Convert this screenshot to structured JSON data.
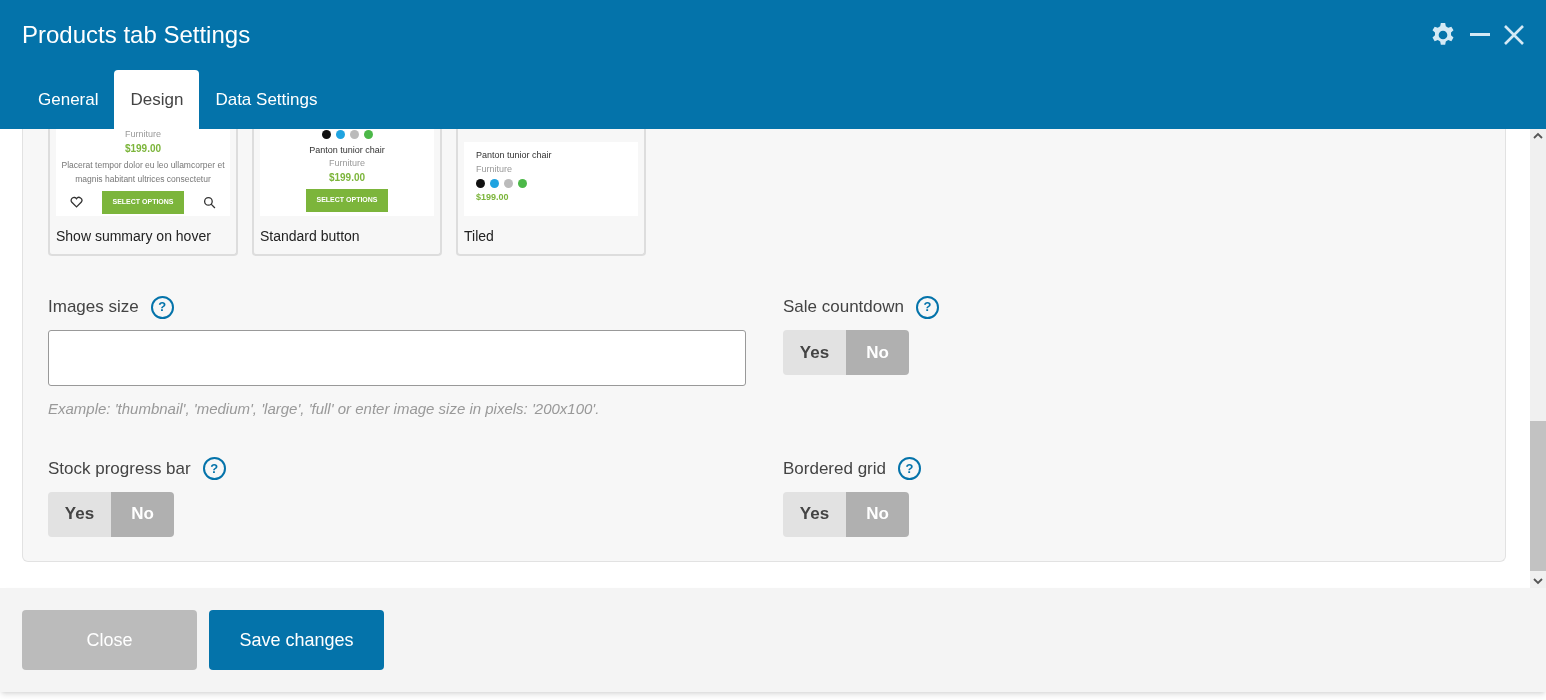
{
  "window": {
    "title": "Products tab Settings"
  },
  "tabs": [
    {
      "label": "General",
      "selected": false
    },
    {
      "label": "Design",
      "selected": true
    },
    {
      "label": "Data Settings",
      "selected": false
    }
  ],
  "design_cards": [
    {
      "kind": "hover",
      "category": "Furniture",
      "price": "$199.00",
      "summary": "Placerat tempor dolor eu leo ullamcorper et magnis habitant ultrices consectetur",
      "button": "SELECT OPTIONS",
      "label": "Show summary on hover"
    },
    {
      "kind": "standard",
      "swatches": [
        {
          "color": "#111111"
        },
        {
          "color": "#1fa3e0"
        },
        {
          "color": "#bbbbbb"
        },
        {
          "color": "#4cb848"
        }
      ],
      "product": "Panton tunior chair",
      "category": "Furniture",
      "price": "$199.00",
      "button": "SELECT OPTIONS",
      "label": "Standard button"
    },
    {
      "kind": "tiled",
      "product": "Panton tunior chair",
      "category": "Furniture",
      "swatches": [
        {
          "color": "#111111"
        },
        {
          "color": "#1fa3e0"
        },
        {
          "color": "#bbbbbb"
        },
        {
          "color": "#4cb848"
        }
      ],
      "price": "$199.00",
      "label": "Tiled"
    }
  ],
  "fields": [
    {
      "kind": "text",
      "label": "Images size",
      "help": "?",
      "hint": "Example: 'thumbnail', 'medium', 'large', 'full' or enter image size in pixels: '200x100'."
    },
    {
      "kind": "toggle",
      "label": "Sale countdown",
      "help": "?",
      "options": [
        {
          "label": "Yes",
          "selected": false
        },
        {
          "label": "No",
          "selected": true
        }
      ]
    },
    {
      "kind": "toggle",
      "label": "Stock progress bar",
      "help": "?",
      "options": [
        {
          "label": "Yes",
          "selected": false
        },
        {
          "label": "No",
          "selected": true
        }
      ]
    },
    {
      "kind": "toggle",
      "label": "Bordered grid",
      "help": "?",
      "options": [
        {
          "label": "Yes",
          "selected": false
        },
        {
          "label": "No",
          "selected": true
        }
      ]
    }
  ],
  "footer": {
    "close": "Close",
    "save": "Save changes"
  }
}
